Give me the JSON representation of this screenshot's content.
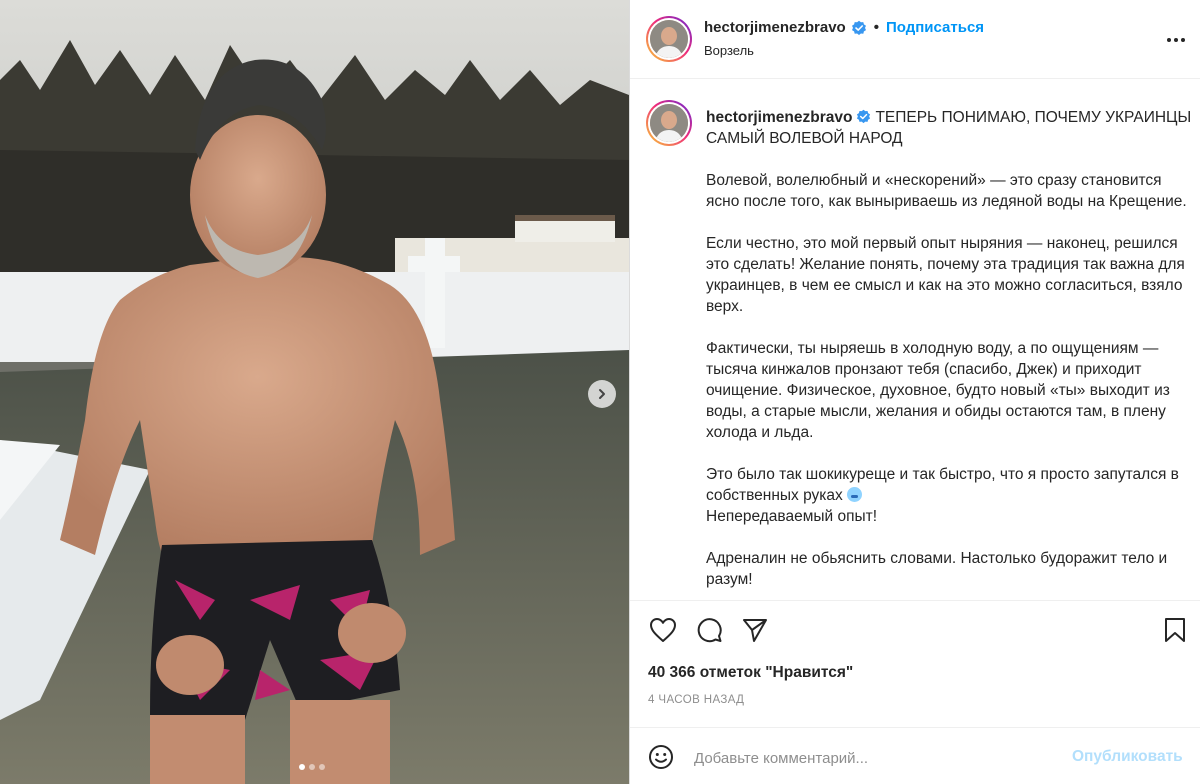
{
  "post": {
    "author": {
      "username": "hectorjimenezbravo",
      "verified": true,
      "location": "Ворзель"
    },
    "header": {
      "separator": "•",
      "follow_label": "Подписаться",
      "more_icon": "more-horizontal-icon"
    },
    "caption": {
      "username": "hectorjimenezbravo",
      "headline": "ТЕПЕРЬ ПОНИМАЮ, ПОЧЕМУ УКРАИНЦЫ САМЫЙ ВОЛЕВОЙ НАРОД",
      "paragraphs": [
        "Волевой, волелюбный и «нескорений» — это сразу становится ясно после того, как выныриваешь из ледяной воды на Крещение.",
        "Если честно, это мой первый опыт ныряния — наконец, решился это сделать! Желание понять, почему эта традиция так важна для украинцев, в чем ее смысл и как на это можно согласиться, взяло верх.",
        "Фактически, ты ныряешь в холодную воду, а по ощущениям — тысяча кинжалов пронзают тебя (спасибо, Джек) и приходит очищение. Физическое, духовное, будто новый «ты» выходит из воды, а старые мысли, желания и обиды остаются там, в плену холода и льда.",
        "Это было так шокикуреще и так быстро, что я просто запутался в собственных руках",
        "Непередаваемый опыт!",
        "Адреналин не обьяснить словами. Настолько будоражит тело и разум!"
      ]
    },
    "actions": {
      "like_icon": "heart-icon",
      "comment_icon": "comment-icon",
      "share_icon": "share-icon",
      "save_icon": "bookmark-icon"
    },
    "likes": "40 366 отметок \"Нравится\"",
    "time_ago": "4 ЧАСОВ НАЗАД",
    "comment": {
      "placeholder": "Добавьте комментарий...",
      "publish_label": "Опубликовать",
      "emoji_icon": "smile-icon"
    },
    "carousel": {
      "current": 1,
      "total": 3,
      "next_icon": "chevron-right-icon"
    }
  },
  "colors": {
    "link_blue": "#0095f6",
    "publish_disabled": "#b2dffc",
    "verified_blue": "#3897f0",
    "muted": "#8e8e8e"
  }
}
